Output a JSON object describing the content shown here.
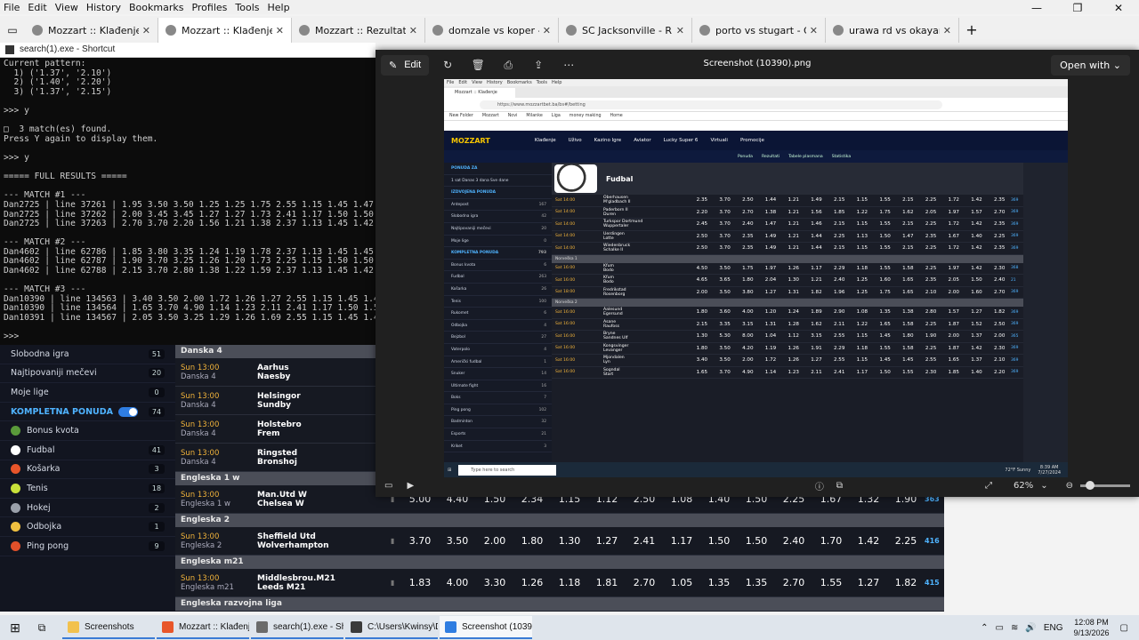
{
  "browser": {
    "menu": [
      "File",
      "Edit",
      "View",
      "History",
      "Bookmarks",
      "Profiles",
      "Tools",
      "Help"
    ],
    "tabs": [
      {
        "label": "Mozzart :: Klađenje",
        "active": false
      },
      {
        "label": "Mozzart :: Klađenje",
        "active": true
      },
      {
        "label": "Mozzart :: Rezultati",
        "active": false
      },
      {
        "label": "domzale vs koper - Google pretraga",
        "active": false
      },
      {
        "label": "SC Jacksonville - Rhode Island F.C.",
        "active": false
      },
      {
        "label": "porto vs stugart - Google pretraga",
        "active": false
      },
      {
        "label": "urawa rd vs okayama prediction",
        "active": false
      }
    ],
    "new_tab_label": "+"
  },
  "console": {
    "title": "search(1).exe - Shortcut",
    "lines": [
      "Current pattern:",
      "  1) ('1.37', '2.10')",
      "  2) ('1.40', '2.20')",
      "  3) ('1.37', '2.15')",
      "",
      ">>> y",
      "",
      "□  3 match(es) found.",
      "Press Y again to display them.",
      "",
      ">>> y",
      "",
      "===== FULL RESULTS =====",
      "",
      "--- MATCH #1 ---",
      "Dan2725 | line 37261 | 1.95 3.50 3.50 1.25 1.25 1.75 2.55 1.15 1.45 1.47 2.50",
      "Dan2725 | line 37262 | 2.00 3.45 3.45 1.27 1.27 1.73 2.41 1.17 1.50 1.50 2.40",
      "Dan2725 | line 37263 | 2.70 3.70 2.20 1.56 1.21 1.38 2.37 1.13 1.45 1.42 2.40",
      "",
      "--- MATCH #2 ---",
      "Dan4602 | line 62786 | 1.85 3.80 3.35 1.24 1.19 1.78 2.37 1.13 1.45 1.45 2.40",
      "Dan4602 | line 62787 | 1.90 3.70 3.25 1.26 1.20 1.73 2.25 1.15 1.50 1.50 2.25",
      "Dan4602 | line 62788 | 2.15 3.70 2.80 1.38 1.22 1.59 2.37 1.13 1.45 1.42 2.40",
      "",
      "--- MATCH #3 ---",
      "Dan10390 | line 134563 | 3.40 3.50 2.00 1.72 1.26 1.27 2.55 1.15 1.45 1.45 2.55",
      "Dan10390 | line 134564 | 1.65 3.70 4.90 1.14 1.23 2.11 2.41 1.17 1.50 1.55 2.30",
      "Dan10391 | line 134567 | 2.05 3.50 3.25 1.29 1.26 1.69 2.55 1.15 1.45 1.45 2.55",
      "",
      ">>>"
    ]
  },
  "mozzart_sidebar": {
    "rows": [
      {
        "label": "Slobodna igra",
        "count": "51"
      },
      {
        "label": "Najtipovaniji mečevi",
        "count": "20"
      },
      {
        "label": "Moje lige",
        "count": "0"
      }
    ],
    "full_offer_label": "KOMPLETNA PONUDA",
    "full_offer_count": "74",
    "sports": [
      {
        "label": "Bonus kvota",
        "count": "",
        "color": "#5a9a3a"
      },
      {
        "label": "Fudbal",
        "count": "41",
        "color": "#ffffff"
      },
      {
        "label": "Košarka",
        "count": "3",
        "color": "#e8552a"
      },
      {
        "label": "Tenis",
        "count": "18",
        "color": "#c9e23a"
      },
      {
        "label": "Hokej",
        "count": "2",
        "color": "#9aa0aa"
      },
      {
        "label": "Odbojka",
        "count": "1",
        "color": "#f0c040"
      },
      {
        "label": "Ping pong",
        "count": "9",
        "color": "#e0502a"
      }
    ]
  },
  "mozzart_matches": [
    {
      "league": "Danska 4"
    },
    {
      "time": "Sun 13:00",
      "league_label": "Danska 4",
      "home": "Aarhus",
      "away": "Naesby",
      "odds": []
    },
    {
      "time": "Sun 13:00",
      "league_label": "Danska 4",
      "home": "Helsingor",
      "away": "Sundby",
      "odds": []
    },
    {
      "time": "Sun 13:00",
      "league_label": "Danska 4",
      "home": "Holstebro",
      "away": "Frem",
      "odds": []
    },
    {
      "time": "Sun 13:00",
      "league_label": "Danska 4",
      "home": "Ringsted",
      "away": "Bronshoj",
      "odds": []
    },
    {
      "league": "Engleska 1 w"
    },
    {
      "time": "Sun 13:00",
      "league_label": "Engleska 1 w",
      "home": "Man.Utd W",
      "away": "Chelsea W",
      "odds": [
        "5.00",
        "4.40",
        "1.50",
        "2.34",
        "1.15",
        "1.12",
        "2.50",
        "1.08",
        "1.40",
        "1.50",
        "2.25",
        "1.67",
        "1.32",
        "1.90"
      ],
      "more": "363"
    },
    {
      "league": "Engleska 2"
    },
    {
      "time": "Sun 13:00",
      "league_label": "Engleska 2",
      "home": "Sheffield Utd",
      "away": "Wolverhampton",
      "odds": [
        "3.70",
        "3.50",
        "2.00",
        "1.80",
        "1.30",
        "1.27",
        "2.41",
        "1.17",
        "1.50",
        "1.50",
        "2.40",
        "1.70",
        "1.42",
        "2.25"
      ],
      "more": "416"
    },
    {
      "league": "Engleska m21"
    },
    {
      "time": "Sun 13:00",
      "league_label": "Engleska m21",
      "home": "Middlesbrou.M21",
      "away": "Leeds M21",
      "odds": [
        "1.83",
        "4.00",
        "3.30",
        "1.26",
        "1.18",
        "1.81",
        "2.70",
        "1.05",
        "1.35",
        "1.35",
        "2.70",
        "1.55",
        "1.27",
        "1.82"
      ],
      "more": "415"
    },
    {
      "league": "Engleska razvojna liga"
    }
  ],
  "photos": {
    "edit_label": "Edit",
    "title": "Screenshot (10390).png",
    "open_with": "Open with",
    "zoom": "62%"
  },
  "inner": {
    "menu": [
      "File",
      "Edit",
      "View",
      "History",
      "Bookmarks",
      "Tools",
      "Help"
    ],
    "tab": "Mozzart :: Klađenje",
    "url": "https://www.mozzartbet.ba/bs#/betting",
    "bookmarks": [
      "New Folder",
      "Mozzart",
      "Novi",
      "Milanke",
      "Liga",
      "money making",
      "Home"
    ],
    "logo": "MOZZART",
    "nav": [
      "Klađenje",
      "Uživo",
      "Kazino Igre",
      "Aviator",
      "Lucky Super 6",
      "Virtuali",
      "Promocije"
    ],
    "sub": [
      "Ponuda",
      "Rezultati",
      "Tabele plasmana",
      "Statistika"
    ],
    "left": [
      {
        "l": "PONUDA ZA",
        "c": "",
        "h": true
      },
      {
        "l": "1 sat   Danas   3 dana   Sve dane",
        "c": "",
        "h": false
      },
      {
        "l": "IZDVOJENA PONUDA",
        "c": "",
        "h": true
      },
      {
        "l": "Antepost",
        "c": "167",
        "h": false
      },
      {
        "l": "Slobodna igra",
        "c": "42",
        "h": false
      },
      {
        "l": "Najtipovaniji mečevi",
        "c": "20",
        "h": false
      },
      {
        "l": "Moje lige",
        "c": "0",
        "h": false
      },
      {
        "l": "KOMPLETNA PONUDA",
        "c": "793",
        "h": true
      },
      {
        "l": "Bonus kvota",
        "c": "6",
        "h": false
      },
      {
        "l": "Fudbal",
        "c": "263",
        "h": false
      },
      {
        "l": "Košarka",
        "c": "26",
        "h": false
      },
      {
        "l": "Tenis",
        "c": "100",
        "h": false
      },
      {
        "l": "Rukomet",
        "c": "6",
        "h": false
      },
      {
        "l": "Odbojka",
        "c": "4",
        "h": false
      },
      {
        "l": "Bejzbol",
        "c": "27",
        "h": false
      },
      {
        "l": "Vaterpolo",
        "c": "4",
        "h": false
      },
      {
        "l": "Američki fudbal",
        "c": "1",
        "h": false
      },
      {
        "l": "Snuker",
        "c": "14",
        "h": false
      },
      {
        "l": "Ultimate fight",
        "c": "16",
        "h": false
      },
      {
        "l": "Boks",
        "c": "7",
        "h": false
      },
      {
        "l": "Ping pong",
        "c": "102",
        "h": false
      },
      {
        "l": "Badminton",
        "c": "32",
        "h": false
      },
      {
        "l": "Esports",
        "c": "21",
        "h": false
      },
      {
        "l": "Kriket",
        "c": "3",
        "h": false
      }
    ],
    "sport_title": "Fudbal",
    "rows": [
      {
        "t": "Sat 14:00",
        "a": "Oberhausen",
        "b": "M'gladbach II",
        "o": [
          "2.35",
          "3.70",
          "2.50",
          "1.44",
          "1.21",
          "1.49",
          "2.15",
          "1.15",
          "1.55",
          "2.15",
          "2.25",
          "1.72",
          "1.42",
          "2.35"
        ],
        "m": "369"
      },
      {
        "t": "Sat 14:00",
        "a": "Paderborn II",
        "b": "Duren",
        "o": [
          "2.20",
          "3.70",
          "2.70",
          "1.38",
          "1.21",
          "1.56",
          "1.85",
          "1.22",
          "1.75",
          "1.62",
          "2.05",
          "1.97",
          "1.57",
          "2.70"
        ],
        "m": "369"
      },
      {
        "t": "Sat 14:00",
        "a": "Turkspor Dortmund",
        "b": "Wuppertaler",
        "o": [
          "2.45",
          "3.70",
          "2.40",
          "1.47",
          "1.21",
          "1.46",
          "2.15",
          "1.15",
          "1.55",
          "2.15",
          "2.25",
          "1.72",
          "1.42",
          "2.35"
        ],
        "m": "369"
      },
      {
        "t": "Sat 14:00",
        "a": "Uerdingen",
        "b": "Lotte",
        "o": [
          "2.50",
          "3.70",
          "2.35",
          "1.49",
          "1.21",
          "1.44",
          "2.25",
          "1.13",
          "1.50",
          "1.47",
          "2.35",
          "1.67",
          "1.40",
          "2.25"
        ],
        "m": "369"
      },
      {
        "t": "Sat 14:00",
        "a": "Wiedenbruck",
        "b": "Schalke II",
        "o": [
          "2.50",
          "3.70",
          "2.35",
          "1.49",
          "1.21",
          "1.44",
          "2.15",
          "1.15",
          "1.55",
          "2.15",
          "2.25",
          "1.72",
          "1.42",
          "2.35"
        ],
        "m": "369"
      },
      {
        "lg": "Norveška 1"
      },
      {
        "t": "Sat 16:00",
        "a": "Kfum",
        "b": "Bodo",
        "o": [
          "4.50",
          "3.50",
          "1.75",
          "1.97",
          "1.26",
          "1.17",
          "2.29",
          "1.18",
          "1.55",
          "1.58",
          "2.25",
          "1.97",
          "1.42",
          "2.30"
        ],
        "m": "368"
      },
      {
        "t": "Sat 16:00",
        "a": "Kfum",
        "b": "Bodo",
        "o": [
          "4.65",
          "3.65",
          "1.80",
          "2.04",
          "1.30",
          "1.21",
          "2.40",
          "1.25",
          "1.60",
          "1.65",
          "2.35",
          "2.05",
          "1.50",
          "2.40"
        ],
        "m": "21"
      },
      {
        "t": "Sat 18:00",
        "a": "Fredrikstad",
        "b": "Rosenborg",
        "o": [
          "2.00",
          "3.50",
          "3.80",
          "1.27",
          "1.31",
          "1.82",
          "1.96",
          "1.25",
          "1.75",
          "1.65",
          "2.10",
          "2.00",
          "1.60",
          "2.70"
        ],
        "m": "369"
      },
      {
        "lg": "Norveška 2"
      },
      {
        "t": "Sat 16:00",
        "a": "Aalesund",
        "b": "Egersund",
        "o": [
          "1.80",
          "3.60",
          "4.00",
          "1.20",
          "1.24",
          "1.89",
          "2.90",
          "1.08",
          "1.35",
          "1.38",
          "2.80",
          "1.57",
          "1.27",
          "1.82"
        ],
        "m": "369"
      },
      {
        "t": "Sat 16:00",
        "a": "Asane",
        "b": "Raufoss",
        "o": [
          "2.15",
          "3.35",
          "3.15",
          "1.31",
          "1.28",
          "1.62",
          "2.11",
          "1.22",
          "1.65",
          "1.58",
          "2.25",
          "1.87",
          "1.52",
          "2.50"
        ],
        "m": "369"
      },
      {
        "t": "Sat 16:00",
        "a": "Bryne",
        "b": "Sandnes Ulf",
        "o": [
          "1.30",
          "5.30",
          "8.00",
          "1.04",
          "1.12",
          "3.15",
          "2.55",
          "1.15",
          "1.45",
          "1.80",
          "1.90",
          "2.00",
          "1.37",
          "2.00"
        ],
        "m": "365"
      },
      {
        "t": "Sat 16:00",
        "a": "Kongsvinger",
        "b": "Levanger",
        "o": [
          "1.80",
          "3.50",
          "4.20",
          "1.19",
          "1.26",
          "1.91",
          "2.29",
          "1.18",
          "1.55",
          "1.58",
          "2.25",
          "1.87",
          "1.42",
          "2.30"
        ],
        "m": "369"
      },
      {
        "t": "Sat 16:00",
        "a": "Mjondalen",
        "b": "Lyn",
        "o": [
          "3.40",
          "3.50",
          "2.00",
          "1.72",
          "1.26",
          "1.27",
          "2.55",
          "1.15",
          "1.45",
          "1.45",
          "2.55",
          "1.65",
          "1.37",
          "2.10"
        ],
        "m": "369"
      },
      {
        "t": "Sat 16:00",
        "a": "Sogndal",
        "b": "Start",
        "o": [
          "1.65",
          "3.70",
          "4.90",
          "1.14",
          "1.23",
          "2.11",
          "2.41",
          "1.17",
          "1.50",
          "1.55",
          "2.30",
          "1.85",
          "1.40",
          "2.20"
        ],
        "m": "369"
      }
    ],
    "search_placeholder": "Type here to search",
    "weather": "72°F Sunny",
    "time": "8:39 AM",
    "date": "7/27/2024"
  },
  "taskbar": {
    "apps": [
      {
        "label": "Screenshots",
        "color": "#f2c14e"
      },
      {
        "label": "Mozzart :: Klađenje",
        "color": "#e8562a"
      },
      {
        "label": "search(1).exe - Sho...",
        "color": "#6b6b6b"
      },
      {
        "label": "C:\\Users\\Kwinsy\\D...",
        "color": "#3a3a3a"
      },
      {
        "label": "Screenshot (10390)....",
        "color": "#2f7de1",
        "active": true
      }
    ],
    "lang": "ENG",
    "time": "12:08 PM",
    "date": "9/13/2026"
  }
}
